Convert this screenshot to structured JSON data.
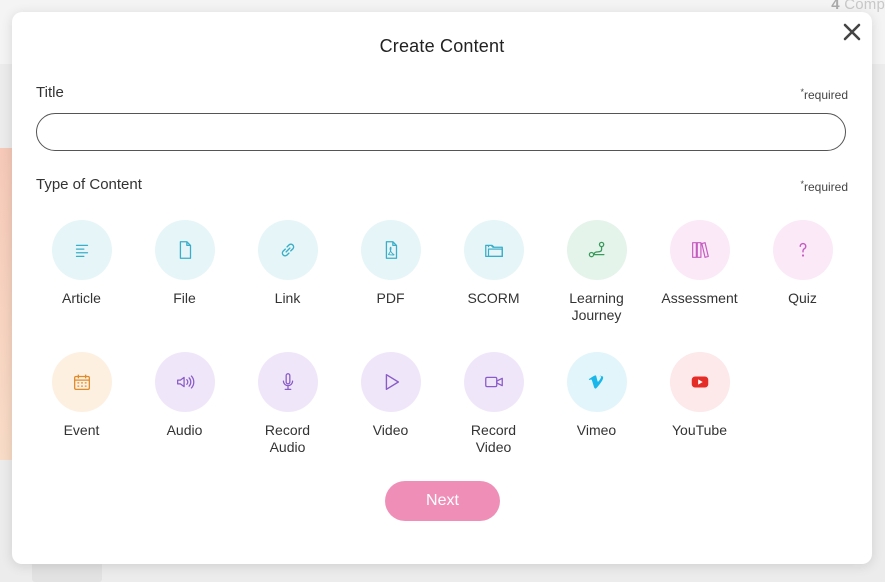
{
  "background": {
    "corner_number": "4",
    "corner_text": "Comp"
  },
  "modal": {
    "title": "Create Content",
    "close_icon": "close-icon",
    "title_field": {
      "label": "Title",
      "required": "required",
      "value": "",
      "placeholder": ""
    },
    "type_field": {
      "label": "Type of Content",
      "required": "required"
    },
    "content_types": [
      {
        "label": "Article",
        "icon": "article-icon",
        "bg": "#e6f5f8",
        "color": "#3aaec8"
      },
      {
        "label": "File",
        "icon": "file-icon",
        "bg": "#e6f5f8",
        "color": "#3aaec8"
      },
      {
        "label": "Link",
        "icon": "link-icon",
        "bg": "#e6f5f8",
        "color": "#3aaec8"
      },
      {
        "label": "PDF",
        "icon": "pdf-icon",
        "bg": "#e6f5f8",
        "color": "#3aaec8"
      },
      {
        "label": "SCORM",
        "icon": "folder-icon",
        "bg": "#e6f5f8",
        "color": "#3aaec8"
      },
      {
        "label": "Learning\nJourney",
        "icon": "journey-icon",
        "bg": "#e4f4ea",
        "color": "#3a9a5c"
      },
      {
        "label": "Assessment",
        "icon": "books-icon",
        "bg": "#fbe9f7",
        "color": "#c45cc0"
      },
      {
        "label": "Quiz",
        "icon": "question-icon",
        "bg": "#fbe9f7",
        "color": "#c45cc0"
      },
      {
        "label": "Event",
        "icon": "calendar-icon",
        "bg": "#fdf0e0",
        "color": "#e08a2a"
      },
      {
        "label": "Audio",
        "icon": "speaker-icon",
        "bg": "#efe6fa",
        "color": "#8a5cc8"
      },
      {
        "label": "Record\nAudio",
        "icon": "microphone-icon",
        "bg": "#efe6fa",
        "color": "#8a5cc8"
      },
      {
        "label": "Video",
        "icon": "play-icon",
        "bg": "#efe6fa",
        "color": "#8a5cc8"
      },
      {
        "label": "Record\nVideo",
        "icon": "video-camera-icon",
        "bg": "#efe6fa",
        "color": "#8a5cc8"
      },
      {
        "label": "Vimeo",
        "icon": "vimeo-icon",
        "bg": "#e2f5fa",
        "color": "#1ab7ea"
      },
      {
        "label": "YouTube",
        "icon": "youtube-icon",
        "bg": "#fde8ea",
        "color": "#e52d27"
      }
    ],
    "next_label": "Next",
    "next_color": "#ef8fb8"
  }
}
